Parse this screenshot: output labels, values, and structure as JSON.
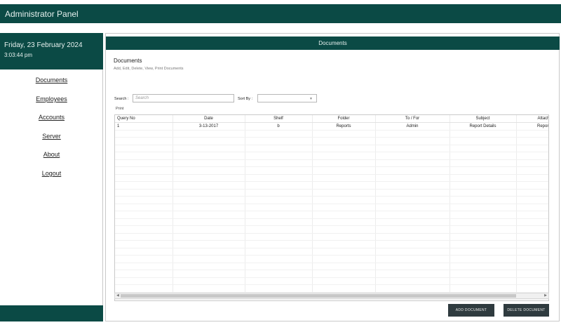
{
  "app": {
    "title": "Administrator Panel"
  },
  "sidebar": {
    "date": "Friday, 23 February 2024",
    "time": "3:03:44 pm",
    "items": [
      {
        "label": "Documents"
      },
      {
        "label": "Employees"
      },
      {
        "label": "Accounts"
      },
      {
        "label": "Server"
      },
      {
        "label": "About"
      },
      {
        "label": "Logout"
      }
    ]
  },
  "main": {
    "header": "Documents",
    "section_title": "Documents",
    "section_subtitle": "Add, Edit, Delete, View, Print Documents",
    "search": {
      "label": "Search :",
      "placeholder": "Search"
    },
    "sort": {
      "label": "Sort By :",
      "value": ""
    },
    "print_label": "Print",
    "table": {
      "columns": [
        "Query No",
        "Date",
        "Shelf",
        "Folder",
        "To / For",
        "Subject",
        "Attach"
      ],
      "rows": [
        [
          "1",
          "3-13-2017",
          "b",
          "Reports",
          "Admin",
          "Report Details",
          "Report"
        ]
      ]
    },
    "buttons": {
      "add": "ADD DOCUMENT",
      "delete": "DELETE DOCUMENT"
    }
  },
  "colors": {
    "primary": "#0b4a45",
    "button": "#2f3b3f"
  }
}
